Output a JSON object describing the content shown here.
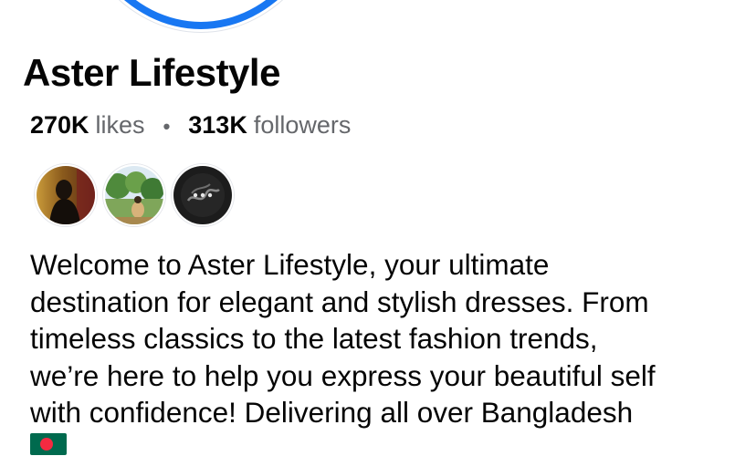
{
  "profile": {
    "name": "Aster Lifestyle",
    "accent_color": "#1877f2"
  },
  "stats": {
    "likes_count": "270K",
    "likes_label": "likes",
    "separator": "•",
    "followers_count": "313K",
    "followers_label": "followers"
  },
  "friends_who_follow": {
    "avatars": [
      {
        "icon": "woman-silhouette-photo"
      },
      {
        "icon": "outdoor-garden-photo"
      },
      {
        "icon": "calligraphy-emblem-photo"
      }
    ]
  },
  "bio": {
    "text": "Welcome to Aster Lifestyle, your ultimate\ndestination for elegant and stylish dresses. From\ntimeless classics to the latest fashion trends,\nwe’re here to help you express your beautiful self\nwith confidence! Delivering all over Bangladesh",
    "flag_icon": "bangladesh-flag-icon",
    "flag_colors": {
      "field": "#006a4e",
      "disc": "#f42a41"
    }
  }
}
